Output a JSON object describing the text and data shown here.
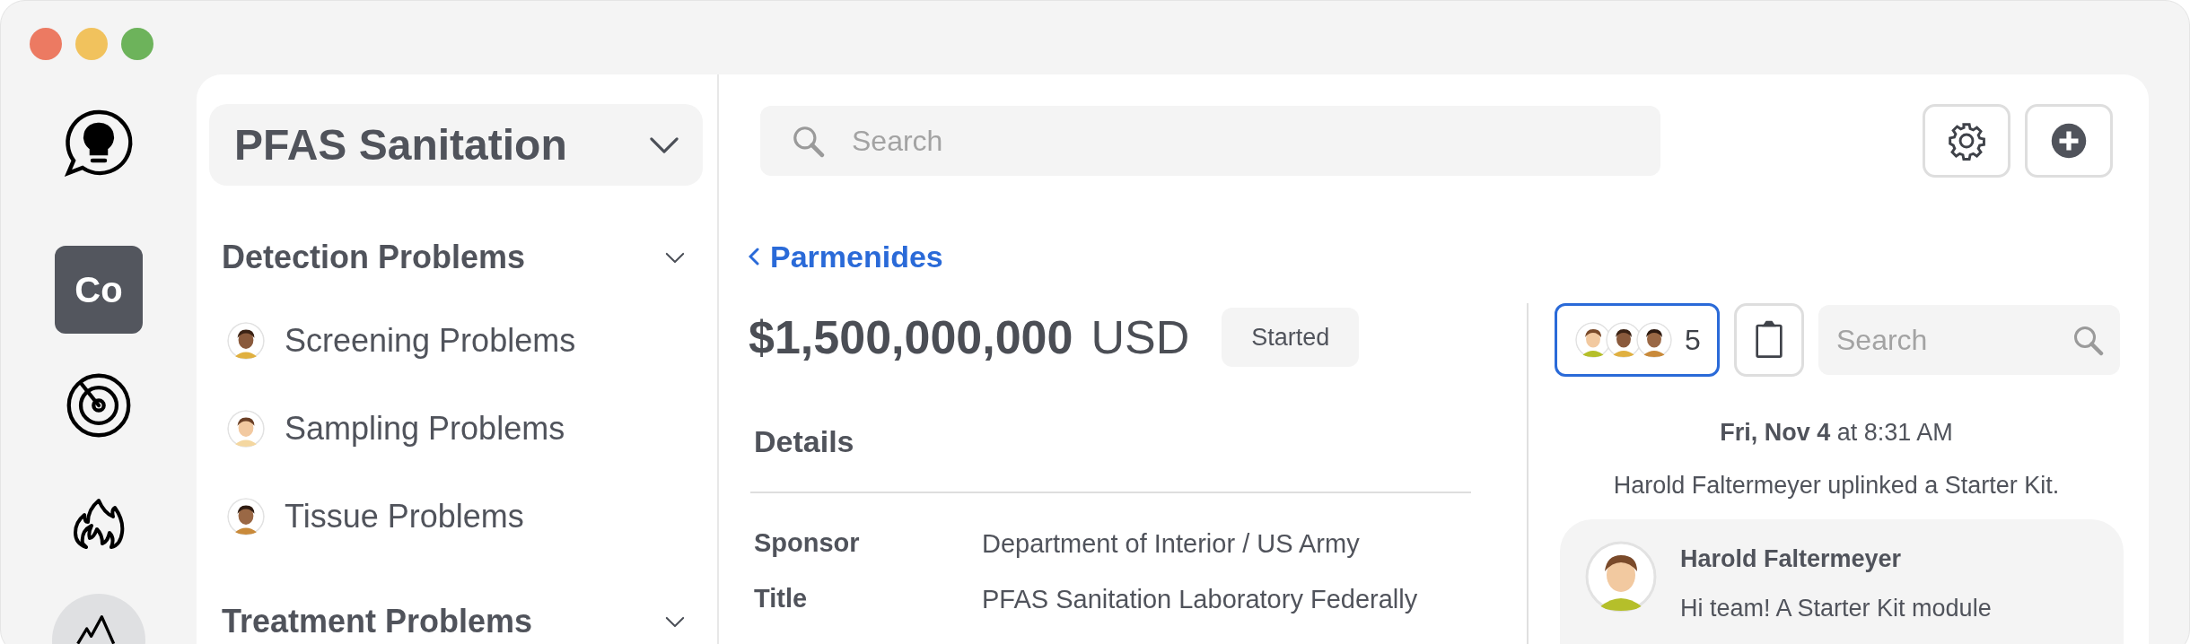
{
  "window": {
    "controls": [
      {
        "color": "#ec7a62"
      },
      {
        "color": "#f1c25d"
      },
      {
        "color": "#6db35b"
      }
    ]
  },
  "rail": {
    "items": [
      {
        "kind": "bulb"
      },
      {
        "kind": "initials",
        "label": "Co"
      },
      {
        "kind": "target"
      },
      {
        "kind": "flame"
      },
      {
        "kind": "mountain"
      }
    ]
  },
  "sidebar": {
    "project": "PFAS Sanitation",
    "sections": [
      {
        "title": "Detection Problems",
        "expanded": true,
        "items": [
          {
            "label": "Screening Problems"
          },
          {
            "label": "Sampling Problems"
          },
          {
            "label": "Tissue Problems"
          }
        ]
      },
      {
        "title": "Treatment Problems",
        "expanded": true
      }
    ]
  },
  "search": {
    "placeholder": "Search"
  },
  "breadcrumb": {
    "back": "Parmenides"
  },
  "funding": {
    "amount": "$1,500,000,000",
    "currency": "USD",
    "status": "Started"
  },
  "details": {
    "title": "Details",
    "rows": [
      {
        "label": "Sponsor",
        "value": "Department of Interior / US Army"
      },
      {
        "label": "Title",
        "value": "PFAS Sanitation Laboratory Federally"
      }
    ]
  },
  "activity": {
    "members": {
      "count": "5",
      "selected": true
    },
    "search": {
      "placeholder": "Search"
    },
    "date": "**Fri, Nov 4** at 8:31 AM",
    "event": "Harold Faltermeyer uplinked a Starter Kit.",
    "messages": [
      {
        "author": "Harold Faltermeyer",
        "text": "Hi team! A Starter Kit module"
      }
    ]
  }
}
